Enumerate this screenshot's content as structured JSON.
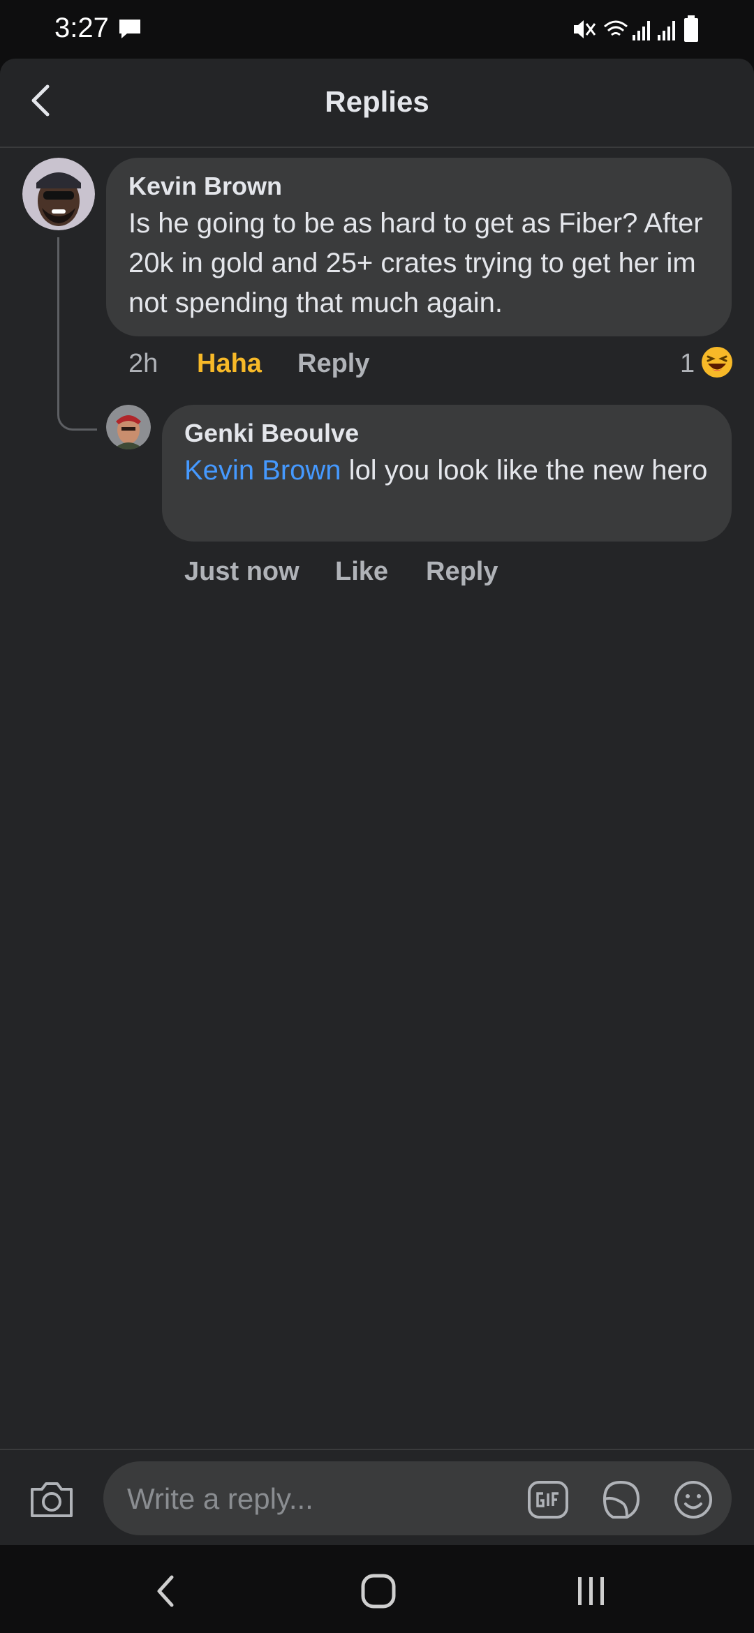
{
  "status_bar": {
    "time": "3:27"
  },
  "header": {
    "title": "Replies"
  },
  "comments": [
    {
      "author": "Kevin Brown",
      "text": "Is he going to be as hard to get as Fiber? After 20k in gold and 25+ crates trying to get her im not spending that much again.",
      "time": "2h",
      "reaction_label": "Haha",
      "reply_label": "Reply",
      "reaction_count": "1"
    },
    {
      "author": "Genki Beoulve",
      "mention": "Kevin Brown",
      "text": " lol you look like the new hero",
      "time": "Just now",
      "like_label": "Like",
      "reply_label": "Reply"
    }
  ],
  "composer": {
    "placeholder": "Write a reply..."
  },
  "colors": {
    "background": "#242527",
    "bubble": "#3a3b3c",
    "mention": "#4599ff",
    "haha": "#f7b928",
    "meta_text": "#b0b3b8"
  },
  "icons": [
    "message-icon",
    "mute-icon",
    "wifi-icon",
    "signal-icon",
    "battery-icon",
    "back-icon",
    "haha-emoji-icon",
    "camera-icon",
    "gif-icon",
    "sticker-icon",
    "emoji-icon",
    "nav-back-icon",
    "nav-home-icon",
    "nav-recents-icon"
  ]
}
